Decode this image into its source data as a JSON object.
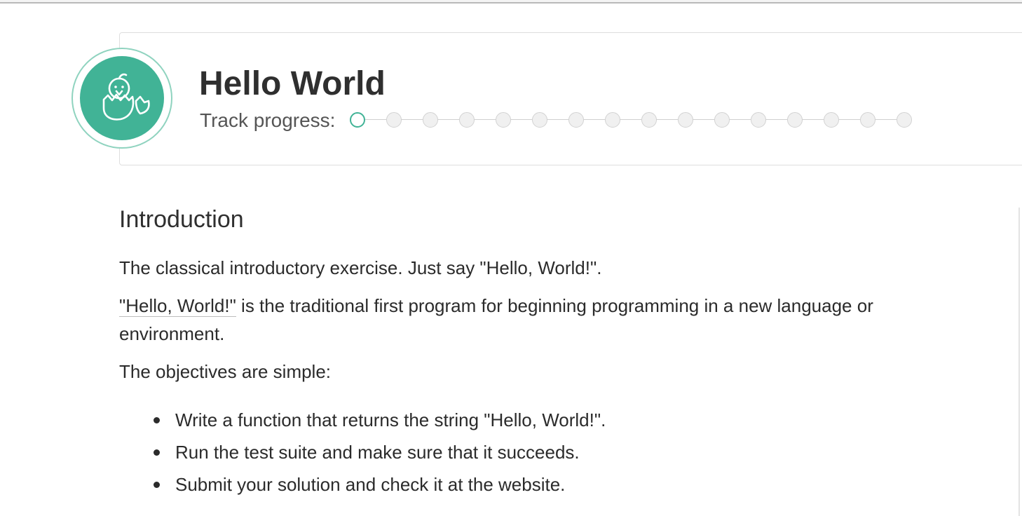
{
  "exercise": {
    "title": "Hello World",
    "icon": "hatching-chick-icon",
    "accent_color": "#41b396"
  },
  "progress": {
    "label": "Track progress:",
    "total_steps": 16,
    "current_step": 1,
    "completed_steps": 0
  },
  "introduction": {
    "heading": "Introduction",
    "paragraph1": "The classical introductory exercise. Just say \"Hello, World!\".",
    "paragraph2_link": "\"Hello, World!\"",
    "paragraph2_text": " is the traditional first program for beginning programming in a new language or environment.",
    "paragraph3": "The objectives are simple:",
    "objectives": [
      "Write a function that returns the string \"Hello, World!\".",
      "Run the test suite and make sure that it succeeds.",
      "Submit your solution and check it at the website."
    ]
  }
}
